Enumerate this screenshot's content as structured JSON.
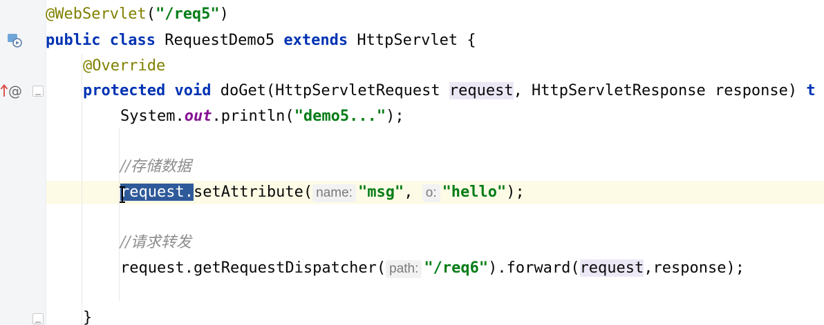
{
  "editor": {
    "line_annotation": "@WebServlet",
    "line_annotation_paren_open": "(",
    "line_annotation_str": "\"/req5\"",
    "line_annotation_paren_close": ")",
    "kw_public": "public",
    "kw_class": "class",
    "class_name": "RequestDemo5",
    "kw_extends": "extends",
    "superclass": "HttpServlet",
    "brace_open": "{",
    "override": "@Override",
    "kw_protected": "protected",
    "kw_void": "void",
    "method_sig_1": "doGet(HttpServletRequest ",
    "param_request": "request",
    "method_sig_2": ", HttpServletResponse response) ",
    "method_sig_trunc": "t",
    "system": "System.",
    "out_field": "out",
    "println": ".println(",
    "demo5_str": "\"demo5...\"",
    "println_end": ");",
    "comment_store": "//存储数据",
    "sel_request": "request.",
    "sel_request_first": "r",
    "set_attr": "setAttribute(",
    "hint_name": "name:",
    "msg_str": "\"msg\"",
    "comma": ", ",
    "hint_o": "o:",
    "hello_str": "\"hello\"",
    "set_attr_end": ");",
    "comment_forward": "//请求转发",
    "req_word": "request",
    "get_dispatcher": ".getRequestDispatcher(",
    "hint_path": "path:",
    "req6_str": "\"/req6\"",
    "forward": ").forward(",
    "forward_req": "request",
    "forward_end": ",response);",
    "brace_close": "}"
  },
  "gutter": {
    "line2_icon": "servlet-run-icon",
    "line4_icon": "override-up-arrow-icon",
    "line4_at": "@",
    "fold_icon": "fold-icon"
  },
  "colors": {
    "keyword": "#0033b3",
    "string": "#067d17",
    "annotation": "#808000",
    "selection": "#2f5a9a",
    "current_line": "#fdfbe6"
  }
}
